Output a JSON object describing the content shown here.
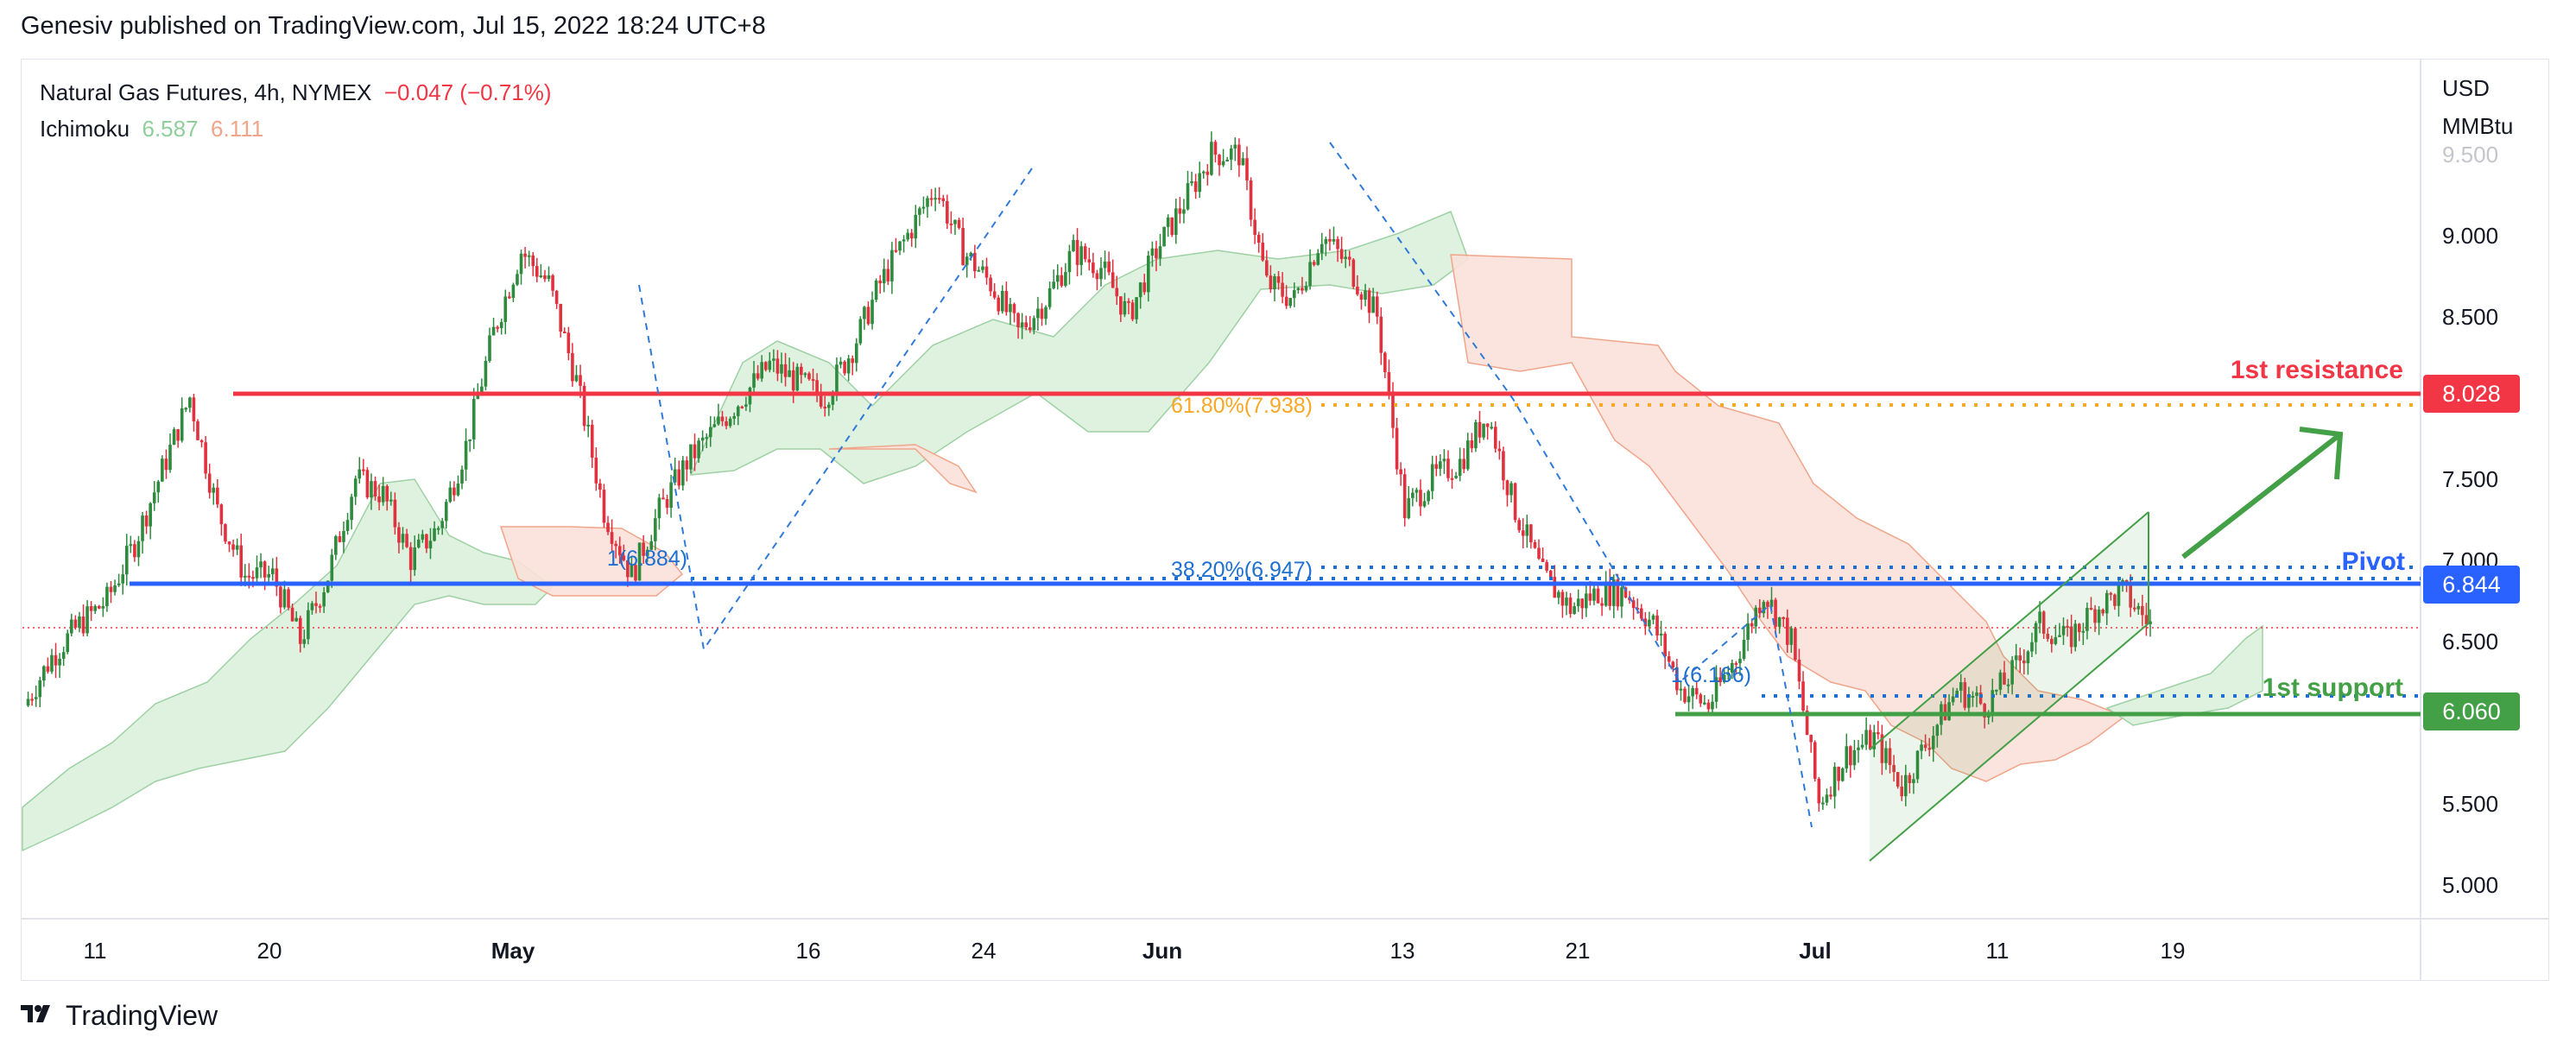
{
  "caption": "Genesiv published on TradingView.com, Jul 15, 2022 18:24 UTC+8",
  "legend": {
    "symbol": "Natural Gas Futures, 4h, NYMEX",
    "change": "−0.047 (−0.71%)",
    "indicator": "Ichimoku",
    "ichimoku_a": "6.587",
    "ichimoku_b": "6.111"
  },
  "price_axis": {
    "unit_line1": "USD",
    "unit_line2": "MMBtu",
    "ticks": [
      "9.500",
      "9.000",
      "8.500",
      "7.500",
      "7.000",
      "6.500",
      "5.500",
      "5.000"
    ]
  },
  "time_axis": {
    "ticks": [
      "11",
      "20",
      "May",
      "16",
      "24",
      "Jun",
      "13",
      "21",
      "Jul",
      "11",
      "19"
    ]
  },
  "price_labels": [
    {
      "value": "8.028",
      "color": "#f23645"
    },
    {
      "value": "6.844",
      "color": "#2962ff"
    },
    {
      "value": "6.060",
      "color": "#43a047"
    }
  ],
  "annotations": {
    "resistance": "1st resistance",
    "pivot": "Pivot",
    "support": "1st support",
    "fib_618": "61.80%(7.938)",
    "fib_382": "38.20%(6.947)",
    "fib_1_top": "1(6.884)",
    "fib_1_bottom": "1(6.166)"
  },
  "colors": {
    "resistance": "#f23645",
    "pivot": "#2962ff",
    "support": "#43a047",
    "fib_618": "#f9a825",
    "fib_382": "#1e6fd0",
    "candle_up": "#2e8b3d",
    "candle_down": "#e2313e",
    "cloud_bull": "#d9efd9",
    "cloud_bear": "#fbe1d9"
  },
  "footer": {
    "brand": "TradingView"
  },
  "chart_data": {
    "type": "candlestick",
    "title": "Natural Gas Futures, 4h, NYMEX",
    "ylabel": "USD/MMBtu",
    "ylim": [
      4.8,
      9.9
    ],
    "x_ticks": [
      "11",
      "20",
      "May",
      "16",
      "24",
      "Jun",
      "13",
      "21",
      "Jul",
      "11",
      "19"
    ],
    "key_levels": [
      {
        "name": "1st resistance",
        "value": 8.028
      },
      {
        "name": "Fibonacci 61.80%",
        "value": 7.938
      },
      {
        "name": "Fibonacci 38.20%",
        "value": 6.947
      },
      {
        "name": "Pivot",
        "value": 6.844
      },
      {
        "name": "1st support",
        "value": 6.06
      }
    ],
    "ichimoku": {
      "span_a": 6.587,
      "span_b": 6.111
    },
    "close_path": [
      6.1,
      6.4,
      6.6,
      6.75,
      7.1,
      7.55,
      8.0,
      7.3,
      6.9,
      6.9,
      6.5,
      6.9,
      7.5,
      7.4,
      7.0,
      7.2,
      7.7,
      8.4,
      8.9,
      8.7,
      8.1,
      7.3,
      6.9,
      7.3,
      7.6,
      7.8,
      8.0,
      8.2,
      8.1,
      8.0,
      8.3,
      8.7,
      9.0,
      9.3,
      8.9,
      8.7,
      8.4,
      8.6,
      8.9,
      8.8,
      8.5,
      8.9,
      9.2,
      9.5,
      9.5,
      8.7,
      8.6,
      9.0,
      8.8,
      8.5,
      7.3,
      7.5,
      7.6,
      7.9,
      7.3,
      6.9,
      6.7,
      6.8,
      6.8,
      6.6,
      6.2,
      6.1,
      6.4,
      6.8,
      6.5,
      5.5,
      5.8,
      5.9,
      5.6,
      5.9,
      6.2,
      6.1,
      6.3,
      6.6,
      6.5,
      6.7,
      6.8,
      6.6
    ]
  }
}
